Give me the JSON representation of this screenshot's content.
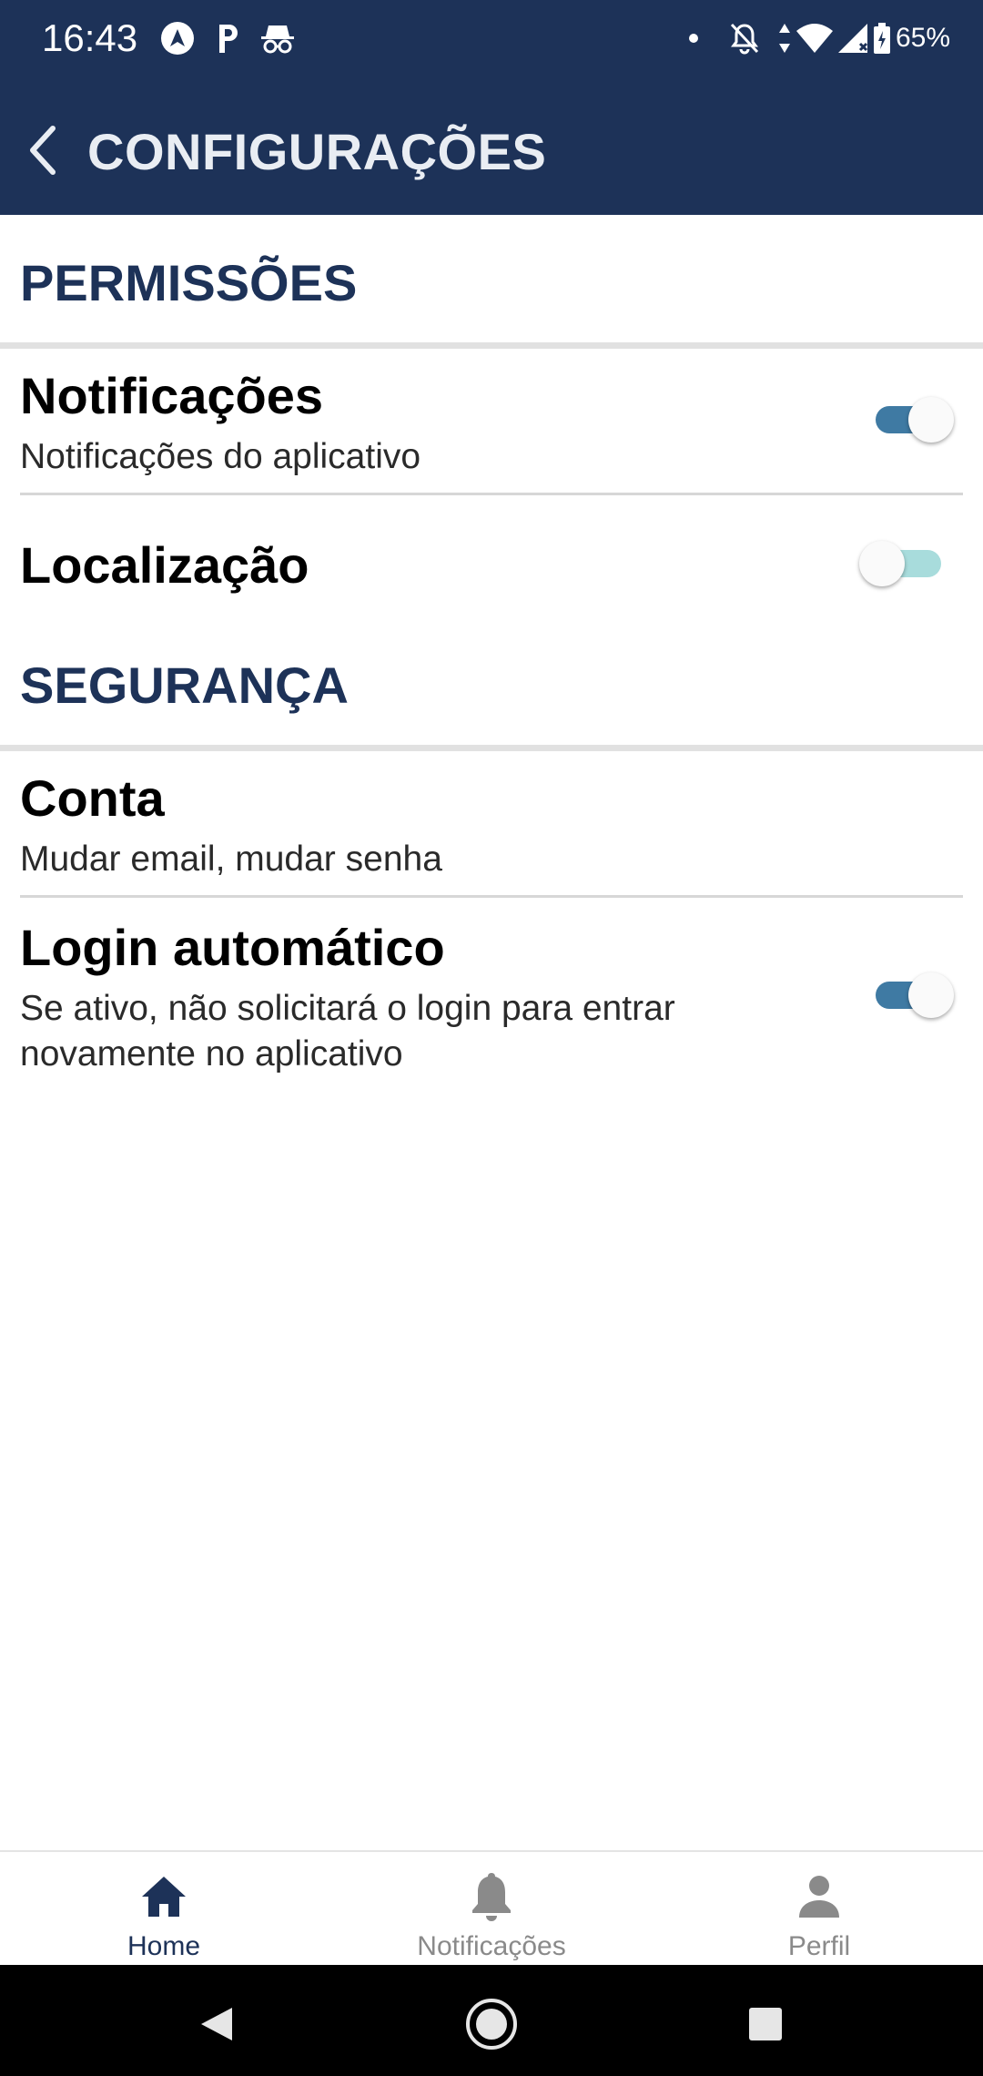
{
  "status_bar": {
    "time": "16:43",
    "battery": "65%",
    "icons": [
      "nav-arrow-icon",
      "parking-icon",
      "incognito-icon",
      "dot-icon",
      "bell-off-icon",
      "data-arrows-icon",
      "wifi-icon",
      "signal-icon",
      "battery-icon"
    ]
  },
  "app_bar": {
    "title": "CONFIGURAÇÕES",
    "back_icon": "chevron-left-icon",
    "background": "#1d3258"
  },
  "sections": {
    "permissions": {
      "title": "PERMISSÕES",
      "notifications": {
        "title": "Notificações",
        "subtitle": "Notificações do aplicativo",
        "enabled": true
      },
      "location": {
        "title": "Localização",
        "enabled": false
      }
    },
    "security": {
      "title": "SEGURANÇA",
      "account": {
        "title": "Conta",
        "subtitle": "Mudar email, mudar senha"
      },
      "auto_login": {
        "title": "Login automático",
        "subtitle_line1": "Se ativo, não solicitará o login para entrar",
        "subtitle_line2": "novamente no aplicativo",
        "enabled": true
      }
    }
  },
  "bottom_nav": {
    "items": [
      {
        "label": "Home",
        "icon": "home-icon",
        "active": true
      },
      {
        "label": "Notificações",
        "icon": "bell-icon",
        "active": false
      },
      {
        "label": "Perfil",
        "icon": "person-icon",
        "active": false
      }
    ]
  },
  "colors": {
    "primary": "#1d3258",
    "toggle_on": "#3f7aa3",
    "toggle_off_track": "#a8dcdc",
    "inactive_nav": "#8a8a8a"
  }
}
